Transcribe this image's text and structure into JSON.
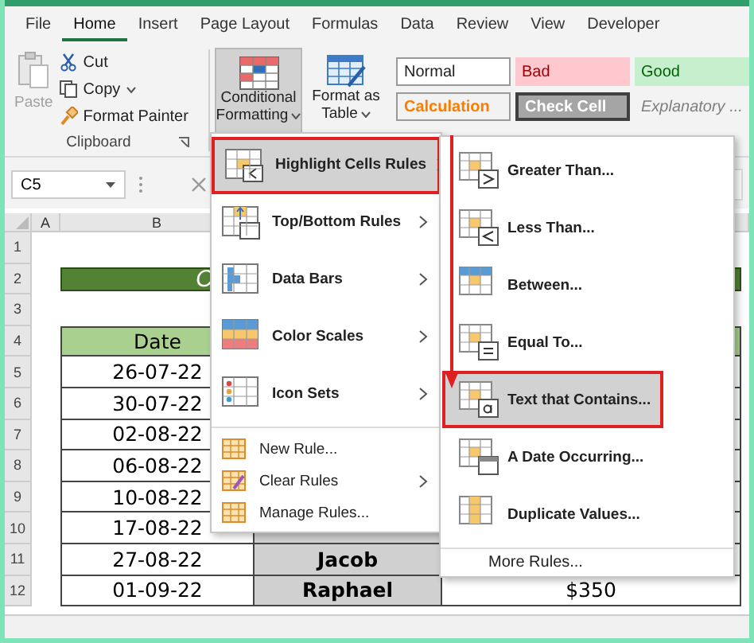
{
  "ribbon_tabs": [
    {
      "label": "File",
      "selected": false
    },
    {
      "label": "Home",
      "selected": true
    },
    {
      "label": "Insert",
      "selected": false
    },
    {
      "label": "Page Layout",
      "selected": false
    },
    {
      "label": "Formulas",
      "selected": false
    },
    {
      "label": "Data",
      "selected": false
    },
    {
      "label": "Review",
      "selected": false
    },
    {
      "label": "View",
      "selected": false
    },
    {
      "label": "Developer",
      "selected": false
    }
  ],
  "clipboard": {
    "paste": "Paste",
    "paste_disabled": true,
    "cut": "Cut",
    "copy": "Copy",
    "format_painter": "Format Painter",
    "label": "Clipboard"
  },
  "styles_buttons": [
    {
      "lines": [
        "Conditional",
        "Formatting"
      ],
      "pressed": true
    },
    {
      "lines": [
        "Format as",
        "Table"
      ],
      "pressed": false
    }
  ],
  "cell_styles": [
    {
      "label": "Normal",
      "kind": "normal"
    },
    {
      "label": "Bad",
      "kind": "bad"
    },
    {
      "label": "Good",
      "kind": "good"
    },
    {
      "label": "Calculation",
      "kind": "calculation"
    },
    {
      "label": "Check Cell",
      "kind": "check"
    },
    {
      "label": "Explanatory ...",
      "kind": "explanatory"
    }
  ],
  "name_box": "C5",
  "column_headers": [
    "A",
    "B"
  ],
  "rows": [
    {
      "number": "1",
      "kind": "blank"
    },
    {
      "number": "2",
      "kind": "title",
      "title": "C"
    },
    {
      "number": "3",
      "kind": "blank"
    },
    {
      "number": "4",
      "kind": "header",
      "date": "Date"
    },
    {
      "number": "5",
      "kind": "data",
      "date": "26-07-22"
    },
    {
      "number": "6",
      "kind": "data",
      "date": "30-07-22"
    },
    {
      "number": "7",
      "kind": "data",
      "date": "02-08-22"
    },
    {
      "number": "8",
      "kind": "data",
      "date": "06-08-22"
    },
    {
      "number": "9",
      "kind": "data",
      "date": "10-08-22"
    },
    {
      "number": "10",
      "kind": "data",
      "date": "17-08-22"
    },
    {
      "number": "11",
      "kind": "data",
      "date": "27-08-22",
      "name": "Jacob"
    },
    {
      "number": "12",
      "kind": "data",
      "date": "01-09-22",
      "name": "Raphael",
      "amount": "$350"
    }
  ],
  "menu": {
    "items": [
      {
        "label": "Highlight Cells Rules",
        "kind": "large",
        "selected": true,
        "submenu": true
      },
      {
        "label": "Top/Bottom Rules",
        "kind": "large",
        "selected": false,
        "submenu": true
      },
      {
        "label": "Data Bars",
        "kind": "large",
        "selected": false,
        "submenu": true
      },
      {
        "label": "Color Scales",
        "kind": "large",
        "selected": false,
        "submenu": true
      },
      {
        "label": "Icon Sets",
        "kind": "large",
        "selected": false,
        "submenu": true
      },
      {
        "label": "New Rule...",
        "kind": "small",
        "selected": false,
        "submenu": false
      },
      {
        "label": "Clear Rules",
        "kind": "small",
        "selected": false,
        "submenu": true
      },
      {
        "label": "Manage Rules...",
        "kind": "small",
        "selected": false,
        "submenu": false
      }
    ]
  },
  "submenu": {
    "items": [
      {
        "label": "Greater Than...",
        "selected": false
      },
      {
        "label": "Less Than...",
        "selected": false
      },
      {
        "label": "Between...",
        "selected": false
      },
      {
        "label": "Equal To...",
        "selected": false
      },
      {
        "label": "Text that Contains...",
        "selected": true
      },
      {
        "label": "A Date Occurring...",
        "selected": false
      },
      {
        "label": "Duplicate Values...",
        "selected": false
      }
    ],
    "more": "More Rules..."
  }
}
